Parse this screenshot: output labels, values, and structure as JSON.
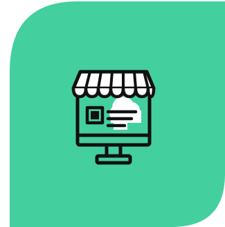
{
  "colors": {
    "tile_fill": "#44cf9f",
    "icon_stroke": "#111111",
    "icon_highlight": "#ffffff",
    "background": "#ffffff"
  },
  "icons": {
    "main": "online-shop-monitor-icon"
  }
}
